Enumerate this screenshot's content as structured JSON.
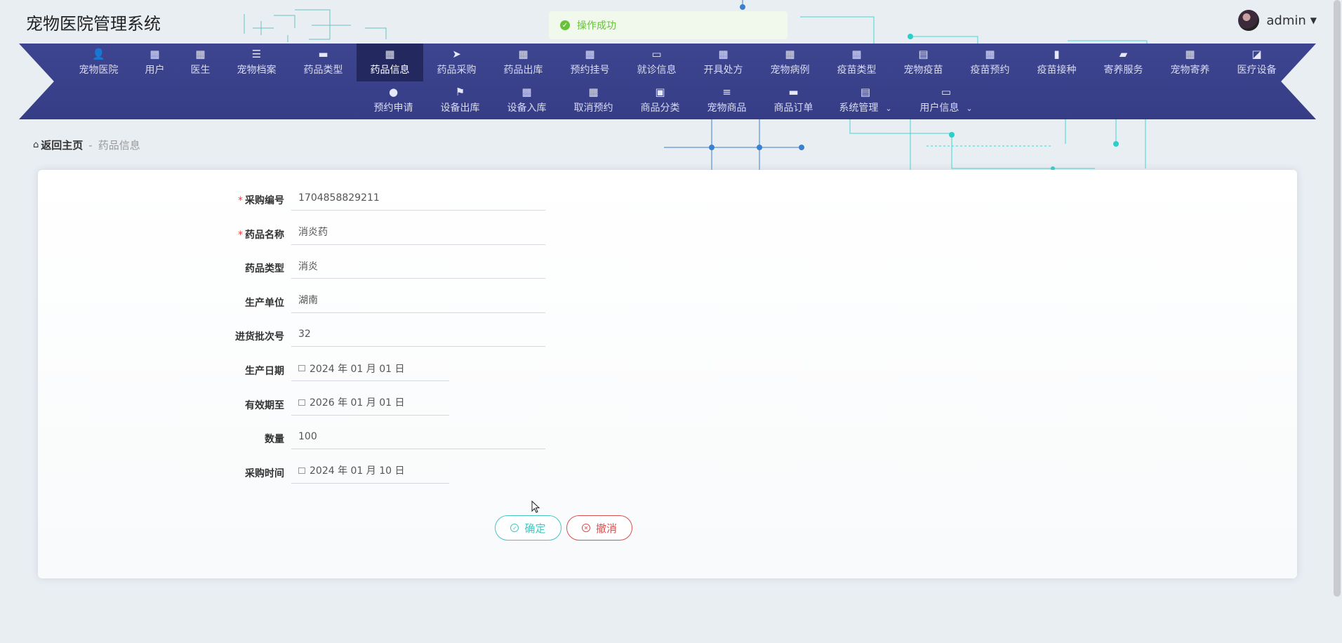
{
  "app": {
    "title": "宠物医院管理系统"
  },
  "toast": {
    "message": "操作成功",
    "color": "#67c23a"
  },
  "user": {
    "name": "admin"
  },
  "nav": {
    "row1": [
      {
        "label": "宠物医院",
        "icon": "person-icon",
        "glyph": "👤"
      },
      {
        "label": "用户",
        "icon": "grid-icon",
        "glyph": "▦"
      },
      {
        "label": "医生",
        "icon": "grid-icon",
        "glyph": "▦"
      },
      {
        "label": "宠物档案",
        "icon": "list-icon",
        "glyph": "☰"
      },
      {
        "label": "药品类型",
        "icon": "monitor-icon",
        "glyph": "▬"
      },
      {
        "label": "药品信息",
        "icon": "grid-icon",
        "glyph": "▦"
      },
      {
        "label": "药品采购",
        "icon": "send-icon",
        "glyph": "➤"
      },
      {
        "label": "药品出库",
        "icon": "grid-icon",
        "glyph": "▦"
      },
      {
        "label": "预约挂号",
        "icon": "grid-icon",
        "glyph": "▦"
      },
      {
        "label": "就诊信息",
        "icon": "monitor-icon",
        "glyph": "▭"
      },
      {
        "label": "开具处方",
        "icon": "grid-icon",
        "glyph": "▦"
      },
      {
        "label": "宠物病例",
        "icon": "grid-icon",
        "glyph": "▦"
      },
      {
        "label": "疫苗类型",
        "icon": "grid-icon",
        "glyph": "▦"
      },
      {
        "label": "宠物疫苗",
        "icon": "clipboard-icon",
        "glyph": "▤"
      },
      {
        "label": "疫苗预约",
        "icon": "grid-icon",
        "glyph": "▦"
      },
      {
        "label": "疫苗接种",
        "icon": "bar-chart-icon",
        "glyph": "▮"
      },
      {
        "label": "寄养服务",
        "icon": "wallet-icon",
        "glyph": "▰"
      },
      {
        "label": "宠物寄养",
        "icon": "grid-icon",
        "glyph": "▦"
      },
      {
        "label": "医疗设备",
        "icon": "line-chart-icon",
        "glyph": "◪"
      }
    ],
    "row2": [
      {
        "label": "预约申请",
        "icon": "bulb-icon",
        "glyph": "●"
      },
      {
        "label": "设备出库",
        "icon": "flag-icon",
        "glyph": "⚑"
      },
      {
        "label": "设备入库",
        "icon": "grid-icon",
        "glyph": "▦"
      },
      {
        "label": "取消预约",
        "icon": "grid-icon",
        "glyph": "▦"
      },
      {
        "label": "商品分类",
        "icon": "clipboard-x-icon",
        "glyph": "▣"
      },
      {
        "label": "宠物商品",
        "icon": "sliders-icon",
        "glyph": "≡"
      },
      {
        "label": "商品订单",
        "icon": "chat-icon",
        "glyph": "▬"
      },
      {
        "label": "系统管理",
        "icon": "clipboard-check-icon",
        "glyph": "▤",
        "dropdown": true
      },
      {
        "label": "用户信息",
        "icon": "card-icon",
        "glyph": "▭",
        "dropdown": true
      }
    ],
    "active": "药品信息"
  },
  "breadcrumb": {
    "home": "返回主页",
    "separator": "-",
    "current": "药品信息"
  },
  "form": {
    "fields": [
      {
        "label": "采购编号",
        "value": "1704858829211",
        "required": true,
        "type": "text"
      },
      {
        "label": "药品名称",
        "value": "消炎药",
        "required": true,
        "type": "text"
      },
      {
        "label": "药品类型",
        "value": "消炎",
        "required": false,
        "type": "text"
      },
      {
        "label": "生产单位",
        "value": "湖南",
        "required": false,
        "type": "text"
      },
      {
        "label": "进货批次号",
        "value": "32",
        "required": false,
        "type": "text"
      },
      {
        "label": "生产日期",
        "value": "2024 年 01 月 01 日",
        "required": false,
        "type": "date"
      },
      {
        "label": "有效期至",
        "value": "2026 年 01 月 01 日",
        "required": false,
        "type": "date"
      },
      {
        "label": "数量",
        "value": "100",
        "required": false,
        "type": "text"
      },
      {
        "label": "采购时间",
        "value": "2024 年 01 月 10 日",
        "required": false,
        "type": "date"
      }
    ],
    "confirm_label": "确定",
    "cancel_label": "撤消"
  },
  "colors": {
    "nav_bg": "#3e4590",
    "nav_active": "#23295f",
    "confirm": "#45c6c0",
    "cancel": "#d9504f"
  }
}
